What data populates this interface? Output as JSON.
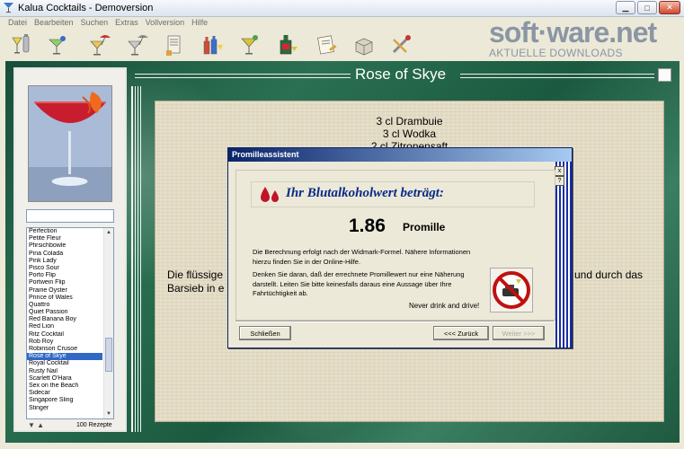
{
  "window": {
    "title": "Kalua Cocktails - Demoversion"
  },
  "menu": [
    "Datei",
    "Bearbeiten",
    "Suchen",
    "Extras",
    "Vollversion",
    "Hilfe"
  ],
  "toolbar": {
    "icons": [
      "cocktail-shaker-icon",
      "martini-glass-icon",
      "cocktail-umbrella-icon",
      "cocktail-umbrella-grey-icon",
      "recipe-book-icon",
      "bottles-icon",
      "cocktail-glass-icon",
      "liqueur-bottle-icon",
      "notepad-icon",
      "open-box-icon",
      "tools-icon"
    ]
  },
  "logo": {
    "main": "soft·ware.net",
    "sub": "AKTUELLE DOWNLOADS"
  },
  "recipe": {
    "title": "Rose of Skye",
    "ingredients": [
      "3 cl  Drambuie",
      "3 cl  Wodka",
      "2 cl  Zitronensaft"
    ],
    "instructions_left": "Die flüssige\nBarsieb in e",
    "instructions_right": "und durch das"
  },
  "cocktail_list": {
    "items": [
      "Perfection",
      "Petite Fleur",
      "Pfirsichbowle",
      "Pina Colada",
      "Pink Lady",
      "Pisco Sour",
      "Porto Flip",
      "Portwein Flip",
      "Prairie Oyster",
      "Prince of Wales",
      "Quattro",
      "Quiet Passion",
      "Red Banana Boy",
      "Red Lion",
      "Ritz Cocktail",
      "Rob Roy",
      "Robinson Crusoe",
      "Rose of Skye",
      "Royal Cocktail",
      "Rusty Nail",
      "Scarlett O'Hara",
      "Sex on the Beach",
      "Sidecar",
      "Singapore Sling",
      "Stinger"
    ],
    "selected": "Rose of Skye",
    "count_label": "100 Rezepte"
  },
  "dialog": {
    "title": "Promilleassistent",
    "banner": "Ihr Blutalkoholwert beträgt:",
    "value": "1.86",
    "unit": "Promille",
    "paragraph1": "Die Berechnung erfolgt nach der Widmark-Formel. Nähere Informationen hierzu finden Sie in der Online-Hilfe.",
    "paragraph2": "Denken Sie daran, daß der errechnete Promillewert nur eine Näherung darstellt. Leiten Sie bitte keinesfalls daraus eine Aussage über Ihre Fahrtüchtigkeit ab.",
    "slogan": "Never drink and drive!",
    "buttons": {
      "close": "Schließen",
      "back": "<<< Zurück",
      "next": "Weiter >>>"
    },
    "icon_help": "?",
    "icon_close": "x"
  },
  "colors": {
    "marble": "#1f5c3e",
    "dialog_title_start": "#0a246a",
    "dialog_title_end": "#a6caf0",
    "list_selection": "#3168c6",
    "banner_text": "#0a2a8a"
  }
}
